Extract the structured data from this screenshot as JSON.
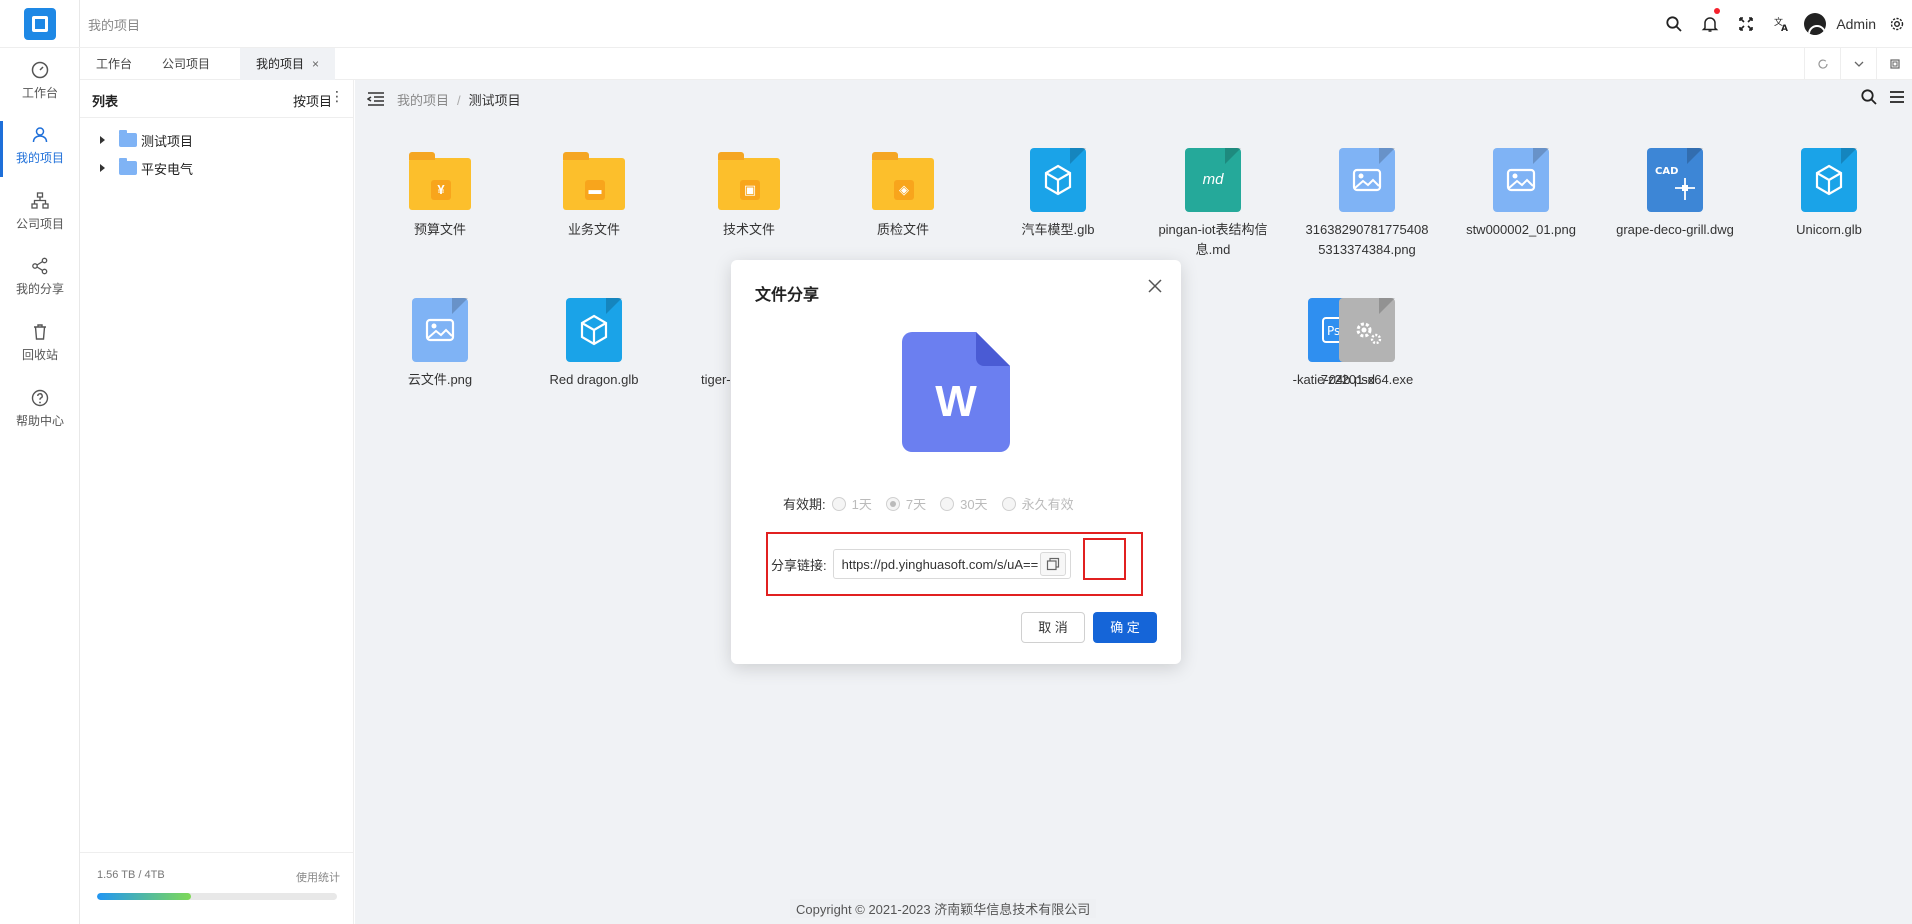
{
  "app": {
    "breadcrumb_title": "我的项目",
    "admin_name": "Admin",
    "accent": "#1e6fd9"
  },
  "nav": [
    {
      "label": "工作台",
      "icon": "dashboard-icon"
    },
    {
      "label": "我的项目",
      "icon": "user-icon",
      "active": true
    },
    {
      "label": "公司项目",
      "icon": "org-icon"
    },
    {
      "label": "我的分享",
      "icon": "share-icon"
    },
    {
      "label": "回收站",
      "icon": "trash-icon"
    },
    {
      "label": "帮助中心",
      "icon": "help-icon"
    }
  ],
  "tabs": [
    {
      "label": "工作台"
    },
    {
      "label": "公司项目"
    },
    {
      "label": "我的项目",
      "close": "×"
    }
  ],
  "tree": {
    "title": "列表",
    "mode": "按项目",
    "nodes": [
      {
        "label": "测试项目"
      },
      {
        "label": "平安电气"
      }
    ],
    "storage_used": "1.56 TB / 4TB",
    "storage_stats": "使用统计",
    "storage_fraction": 0.39
  },
  "main": {
    "breadcrumb": [
      "我的项目",
      "测试项目"
    ],
    "footer": "Copyright © 2021-2023 济南颖华信息技术有限公司"
  },
  "files": [
    {
      "name": "预算文件",
      "kind": "folder",
      "mark": "¥"
    },
    {
      "name": "业务文件",
      "kind": "folder",
      "mark": "briefcase"
    },
    {
      "name": "技术文件",
      "kind": "folder",
      "mark": "chip"
    },
    {
      "name": "质检文件",
      "kind": "folder",
      "mark": "shield"
    },
    {
      "name": "汽车模型.glb",
      "kind": "glb"
    },
    {
      "name": "pingan-iot表结构信息.md",
      "kind": "md"
    },
    {
      "name": "316382907817754085313374384.png",
      "kind": "png"
    },
    {
      "name": "stw000002_01.png",
      "kind": "png"
    },
    {
      "name": "grape-deco-grill.dwg",
      "kind": "cad"
    },
    {
      "name": "Unicorn.glb",
      "kind": "glb"
    },
    {
      "name": "云文件.png",
      "kind": "png"
    },
    {
      "name": "Red dragon.glb",
      "kind": "glb"
    },
    {
      "name": "tiger-c",
      "kind": "other"
    },
    {
      "name": "-katie-04b.psd",
      "kind": "psd"
    },
    {
      "name": "7z2201-x64.exe",
      "kind": "exe"
    }
  ],
  "modal": {
    "title": "文件分享",
    "expiry_label": "有效期:",
    "expiry_options": [
      "1天",
      "7天",
      "30天",
      "永久有效"
    ],
    "expiry_selected": "7天",
    "link_label": "分享链接:",
    "link_value": "https://pd.yinghuasoft.com/s/uA==",
    "cancel": "取 消",
    "ok": "确 定",
    "file_icon_letter": "W"
  }
}
